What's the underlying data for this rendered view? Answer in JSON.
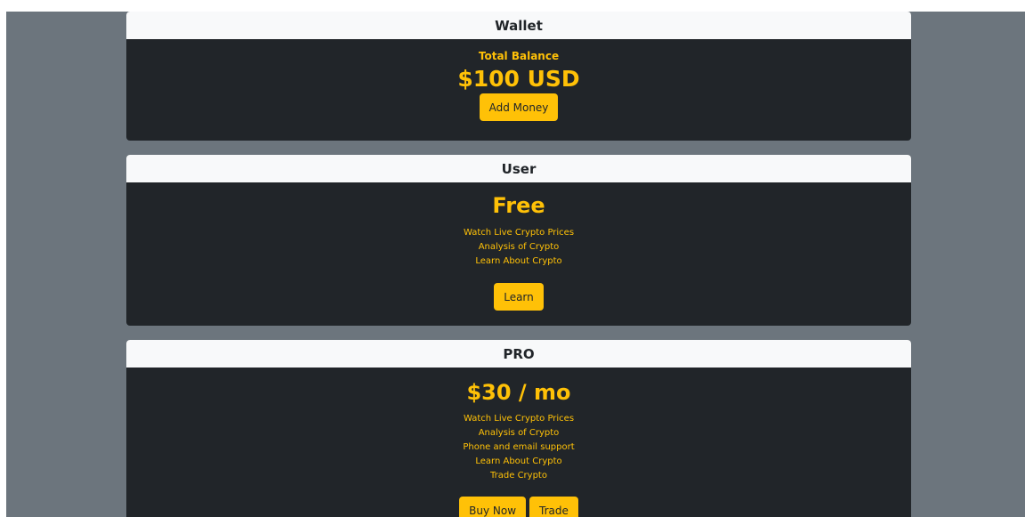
{
  "wallet": {
    "header": "Wallet",
    "balance_label": "Total Balance",
    "balance_amount": "$100 USD",
    "add_money_label": "Add Money"
  },
  "user_plan": {
    "header": "User",
    "plan_name": "Free",
    "features": [
      "Watch Live Crypto Prices",
      "Analysis of Crypto",
      "Learn About Crypto"
    ],
    "learn_label": "Learn"
  },
  "pro_plan": {
    "header": "PRO",
    "price": "$30 / mo",
    "features": [
      "Watch Live Crypto Prices",
      "Analysis of Crypto",
      "Phone and email support",
      "Learn About Crypto",
      "Trade Crypto"
    ],
    "buy_now_label": "Buy Now",
    "trade_label": "Trade"
  },
  "colors": {
    "page_background": "#6c757d",
    "card_background": "#212529",
    "card_header": "#f8f9fa",
    "accent": "#ffc107"
  }
}
